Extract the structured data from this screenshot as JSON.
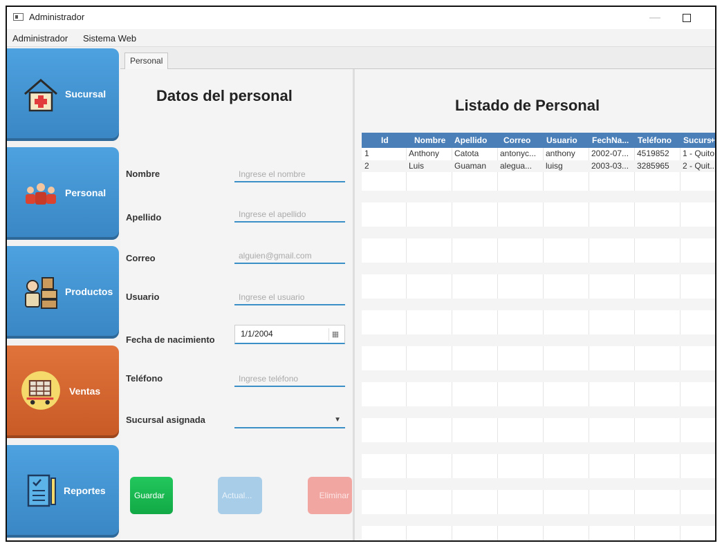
{
  "window": {
    "title": "Administrador",
    "minimize": "—",
    "close": "✕"
  },
  "menu": [
    "Administrador",
    "Sistema Web"
  ],
  "sidebar": {
    "items": [
      {
        "label": "Sucursal",
        "icon": "hospital-icon"
      },
      {
        "label": "Personal",
        "icon": "people-icon"
      },
      {
        "label": "Productos",
        "icon": "worker-boxes-icon"
      },
      {
        "label": "Ventas",
        "icon": "cart-icon",
        "active": true
      },
      {
        "label": "Reportes",
        "icon": "report-clipboard-icon"
      }
    ]
  },
  "tab": {
    "label": "Personal"
  },
  "form": {
    "title": "Datos del  personal",
    "fields": {
      "nombre": {
        "label": "Nombre",
        "placeholder": "Ingrese el nombre"
      },
      "apellido": {
        "label": "Apellido",
        "placeholder": "Ingrese el apellido"
      },
      "correo": {
        "label": "Correo",
        "placeholder": "alguien@gmail.com"
      },
      "usuario": {
        "label": "Usuario",
        "placeholder": "Ingrese el usuario"
      },
      "fecha": {
        "label": "Fecha de nacimiento",
        "value": "1/1/2004",
        "icon": "calendar-icon"
      },
      "telefono": {
        "label": "Teléfono",
        "placeholder": "Ingrese teléfono"
      },
      "sucursal": {
        "label": "Sucursal asignada",
        "value": "",
        "icon": "dropdown-arrow-icon"
      }
    },
    "buttons": {
      "save": "Guardar",
      "update": "Actual...",
      "delete": "Eliminar"
    }
  },
  "list": {
    "title": "Listado de Personal",
    "columns": [
      "Id",
      "Nombre",
      "Apellido",
      "Correo",
      "Usuario",
      "FechNa...",
      "Teléfono",
      "Sucursa"
    ],
    "add_column": "+",
    "rows": [
      [
        "1",
        "Anthony",
        "Catota",
        "antonyc...",
        "anthony",
        "2002-07...",
        "4519852",
        "1 - Quito"
      ],
      [
        "2",
        "Luis",
        "Guaman",
        "alegua...",
        "luisg",
        "2003-03...",
        "3285965",
        "2 - Quit..."
      ]
    ]
  },
  "colors": {
    "sidebar_blue": "#3a86c4",
    "sidebar_active": "#c85a26",
    "header_blue": "#4b7fb8",
    "save_green": "#12a946",
    "update_blue": "#a8cde8",
    "delete_pink": "#f2a6a2"
  }
}
